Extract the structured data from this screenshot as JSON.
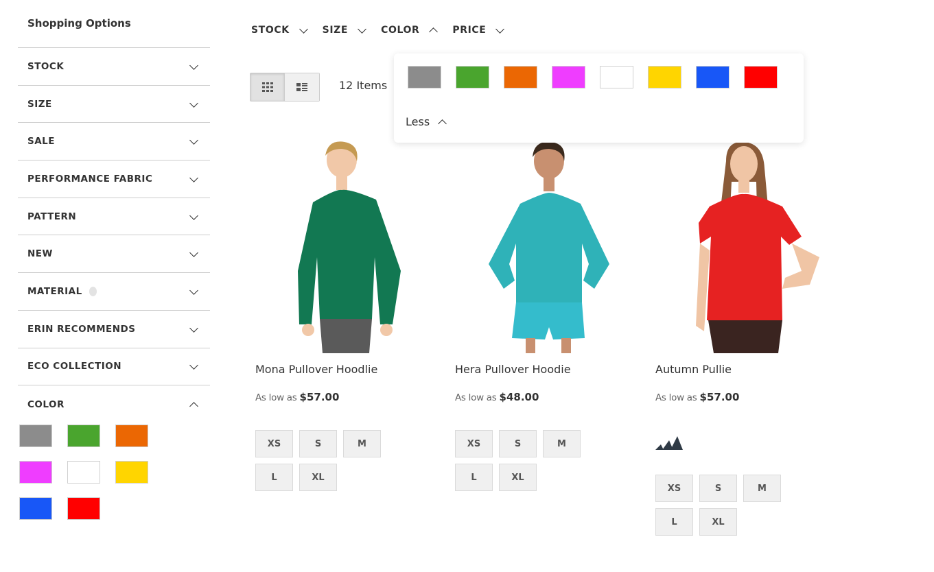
{
  "sidebar": {
    "title": "Shopping Options",
    "filters": [
      {
        "label": "STOCK"
      },
      {
        "label": "SIZE"
      },
      {
        "label": "SALE"
      },
      {
        "label": "PERFORMANCE FABRIC"
      },
      {
        "label": "PATTERN"
      },
      {
        "label": "NEW"
      },
      {
        "label": "MATERIAL"
      },
      {
        "label": "ERIN RECOMMENDS"
      },
      {
        "label": "ECO COLLECTION"
      },
      {
        "label": "COLOR"
      }
    ]
  },
  "colors": {
    "gray": "#8c8c8c",
    "green": "#4aa52e",
    "orange": "#eb6703",
    "purple": "#ef3dff",
    "white": "#ffffff",
    "yellow": "#ffd500",
    "blue": "#1857f7",
    "red": "#ff0000"
  },
  "topbar": {
    "filters": [
      {
        "label": "STOCK",
        "expanded": false
      },
      {
        "label": "SIZE",
        "expanded": false
      },
      {
        "label": "COLOR",
        "expanded": true
      },
      {
        "label": "PRICE",
        "expanded": false
      }
    ]
  },
  "toolbar": {
    "view_modes": [
      "grid-icon",
      "list-icon"
    ],
    "active_mode": "grid",
    "items_count": "12 Items"
  },
  "color_dropdown": {
    "less_label": "Less"
  },
  "products": [
    {
      "name": "Mona Pullover Hoodlie",
      "price_prefix": "As low as",
      "price": "$57.00",
      "sizes": [
        "XS",
        "S",
        "M",
        "L",
        "XL"
      ],
      "shirt_color": "#127852",
      "brand_logo": false
    },
    {
      "name": "Hera Pullover Hoodie",
      "price_prefix": "As low as",
      "price": "$48.00",
      "sizes": [
        "XS",
        "S",
        "M",
        "L",
        "XL"
      ],
      "shirt_color": "#2fb2b8",
      "brand_logo": false
    },
    {
      "name": "Autumn Pullie",
      "price_prefix": "As low as",
      "price": "$57.00",
      "sizes": [
        "XS",
        "S",
        "M",
        "L",
        "XL"
      ],
      "shirt_color": "#e62222",
      "brand_logo": true
    }
  ]
}
